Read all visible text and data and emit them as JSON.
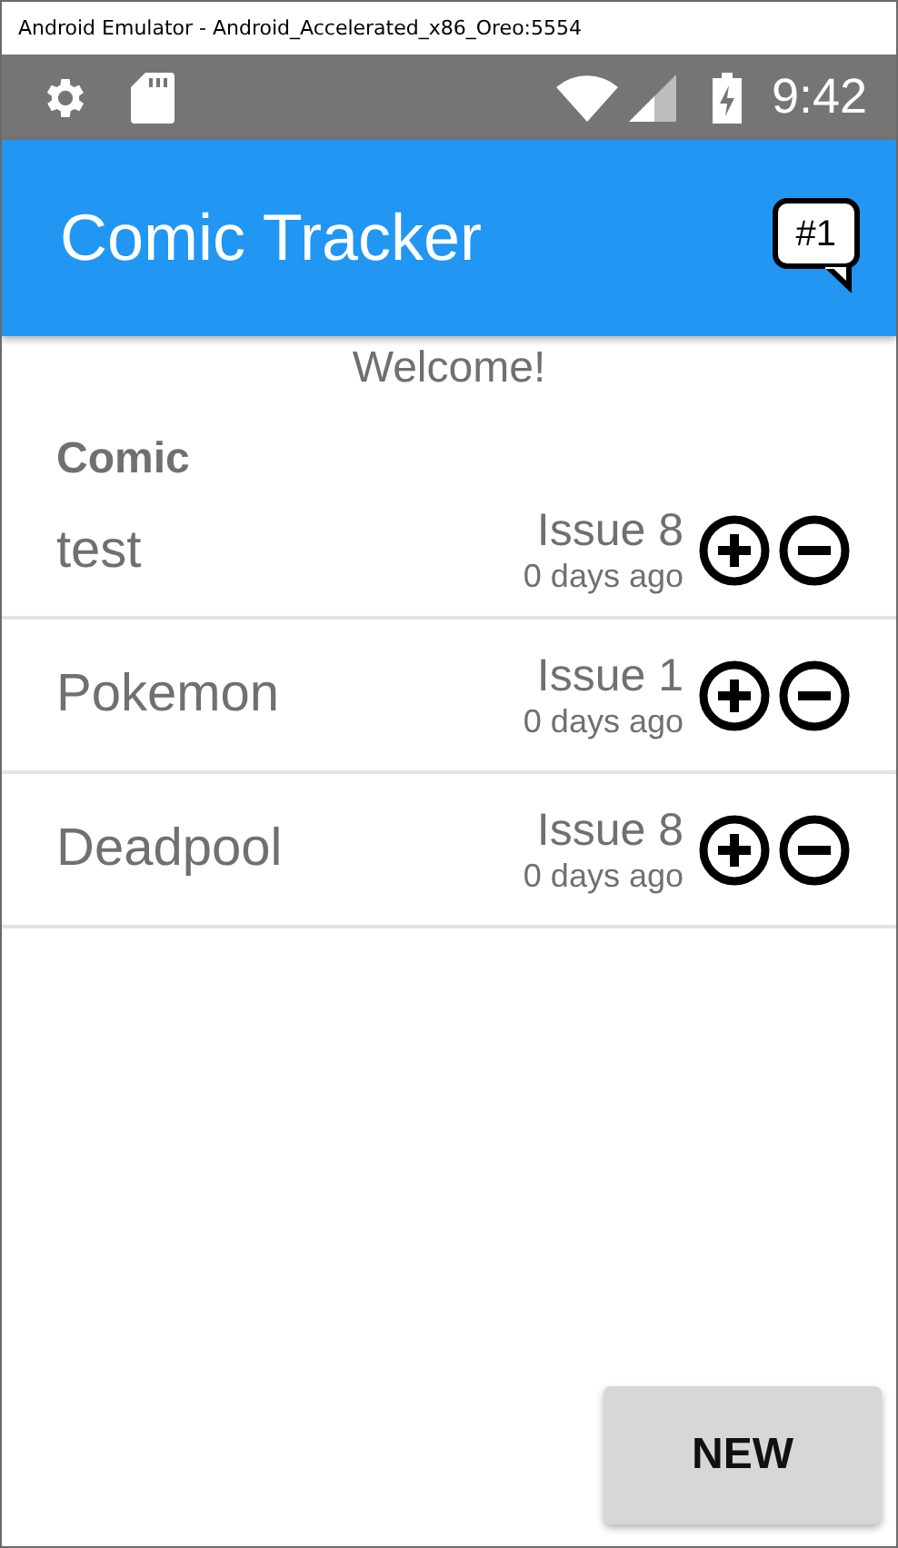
{
  "window": {
    "title": "Android Emulator - Android_Accelerated_x86_Oreo:5554"
  },
  "status_bar": {
    "time": "9:42"
  },
  "app_bar": {
    "title": "Comic Tracker",
    "badge": "#1"
  },
  "welcome": "Welcome!",
  "list_header": "Comic",
  "comics": [
    {
      "name": "test",
      "issue": "Issue 8",
      "updated": "0 days ago"
    },
    {
      "name": "Pokemon",
      "issue": "Issue 1",
      "updated": "0 days ago"
    },
    {
      "name": "Deadpool",
      "issue": "Issue 8",
      "updated": "0 days ago"
    }
  ],
  "new_button": "NEW"
}
